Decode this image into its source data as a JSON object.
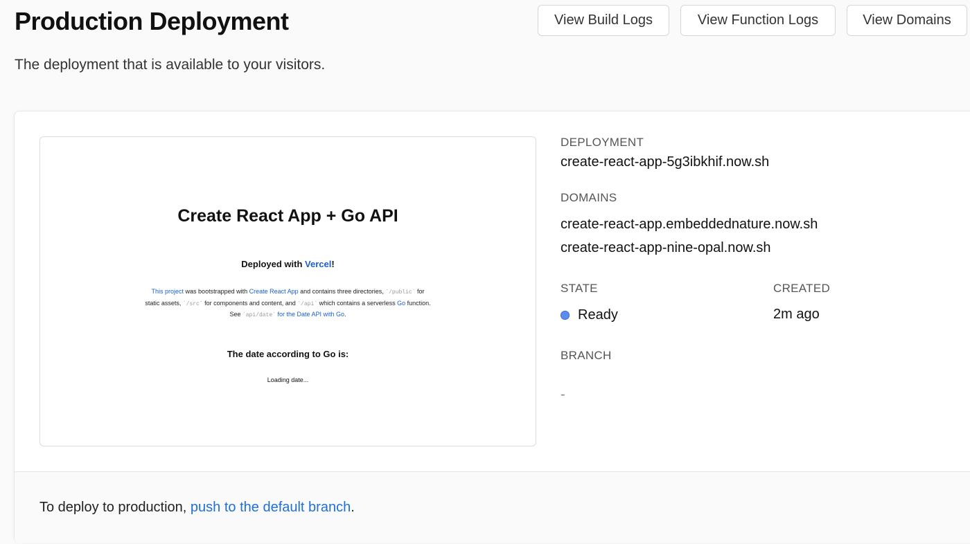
{
  "header": {
    "title": "Production Deployment",
    "subtitle": "The deployment that is available to your visitors.",
    "buttons": {
      "build_logs": "View Build Logs",
      "function_logs": "View Function Logs",
      "domains": "View Domains"
    }
  },
  "preview": {
    "title": "Create React App + Go API",
    "deployed_prefix": "Deployed with ",
    "deployed_link": "Vercel",
    "deployed_suffix": "!",
    "para": {
      "link1": "This project",
      "t1": " was bootstrapped with ",
      "link2": "Create React App",
      "t2": " and contains three directories, ",
      "code1": "`/public`",
      "t3": " for static assets, ",
      "code2": "`/src`",
      "t4": " for components and content, and ",
      "code3": "`/api`",
      "t5": " which contains a serverless ",
      "link3": "Go",
      "t6": " function. See ",
      "code4": "`api/date`",
      "link4": " for the Date API with Go",
      "t7": "."
    },
    "date_heading": "The date according to Go is:",
    "loading": "Loading date..."
  },
  "details": {
    "deployment_label": "DEPLOYMENT",
    "deployment_url": "create-react-app-5g3ibkhif.now.sh",
    "domains_label": "DOMAINS",
    "domains": [
      "create-react-app.embeddednature.now.sh",
      "create-react-app-nine-opal.now.sh"
    ],
    "state_label": "STATE",
    "state_value": "Ready",
    "state_color": "#5b8def",
    "created_label": "CREATED",
    "created_value": "2m ago",
    "branch_label": "BRANCH",
    "branch_value": "-"
  },
  "footer": {
    "prefix": "To deploy to production, ",
    "link": "push to the default branch",
    "suffix": "."
  }
}
